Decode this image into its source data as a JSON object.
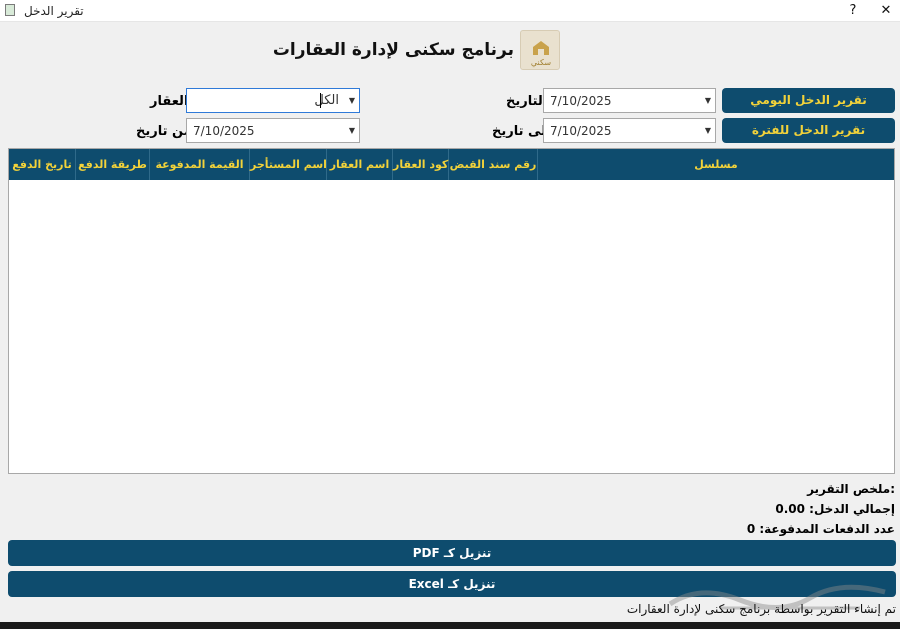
{
  "window": {
    "title": "تقرير الدخل",
    "help_label": "?",
    "close_label": "✕"
  },
  "header": {
    "app_title": "برنامج سكنى لإدارة العقارات",
    "logo_text": "سكني"
  },
  "buttons": {
    "daily_report": "تقرير الدخل اليومي",
    "period_report": "تقرير الدخل للفترة",
    "download_pdf": "PDF تنزيل كـ",
    "download_excel": "Excel تنزيل كـ"
  },
  "filters": {
    "date_label": "التاريخ:",
    "date_value": "7/10/2025",
    "to_date_label": "إلى تاريخ:",
    "to_date_value": "7/10/2025",
    "property_label": "العقار:",
    "property_value": "الكل",
    "from_date_label": "من تاريخ:",
    "from_date_value": "7/10/2025"
  },
  "table": {
    "columns": [
      "مسلسل",
      "رقم سند القبض",
      "كود العقار",
      "اسم العقار",
      "اسم المستأجر",
      "القيمة المدفوعة",
      "طريقة الدفع",
      "تاريخ الدفع"
    ],
    "rows": []
  },
  "summary": {
    "title": "ملخص التقرير:",
    "total_income": "إجمالي الدخل: 0.00",
    "payments_count": "عدد الدفعات المدفوعة: 0"
  },
  "footer": {
    "generated_by": "تم إنشاء التقرير بواسطة برنامج سكنى لإدارة العقارات"
  },
  "colors": {
    "primary": "#0e4c6e",
    "accent_yellow": "#f2d23a",
    "background": "#f0f0f0"
  }
}
